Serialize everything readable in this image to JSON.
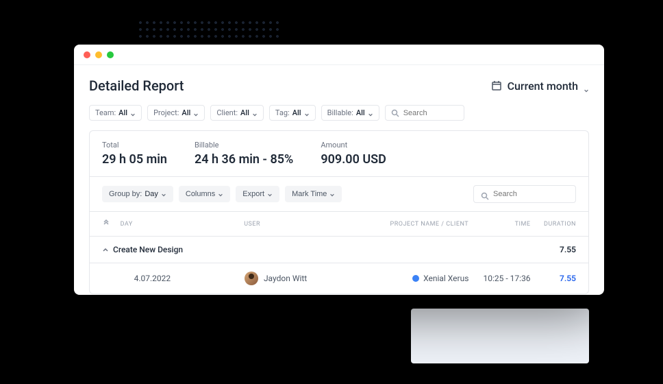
{
  "page_title": "Detailed Report",
  "date_range": {
    "label": "Current month"
  },
  "filters": {
    "team": {
      "label": "Team:",
      "value": "All"
    },
    "project": {
      "label": "Project:",
      "value": "All"
    },
    "client": {
      "label": "Client:",
      "value": "All"
    },
    "tag": {
      "label": "Tag:",
      "value": "All"
    },
    "billable": {
      "label": "Billable:",
      "value": "All"
    },
    "search_placeholder": "Search"
  },
  "stats": {
    "total": {
      "label": "Total",
      "value": "29 h 05 min"
    },
    "billable": {
      "label": "Billable",
      "value": "24 h 36 min - ",
      "pct": "85%"
    },
    "amount": {
      "label": "Amount",
      "value": "909.00 USD"
    }
  },
  "toolbar": {
    "group_by": {
      "label": "Group by:",
      "value": "Day"
    },
    "columns": "Columns",
    "export": "Export",
    "mark_time": "Mark Time",
    "search_placeholder": "Search"
  },
  "table": {
    "headers": {
      "day": "DAY",
      "user": "USER",
      "project": "PROJECT NAME / CLIENT",
      "time": "TIME",
      "duration": "DURATION"
    },
    "group": {
      "name": "Create New Design",
      "duration": "7.55"
    },
    "rows": [
      {
        "day": "4.07.2022",
        "user": "Jaydon Witt",
        "project": "Xenial Xerus",
        "project_color": "#3b82f6",
        "time": "10:25 - 17:36",
        "duration": "7.55"
      }
    ]
  }
}
